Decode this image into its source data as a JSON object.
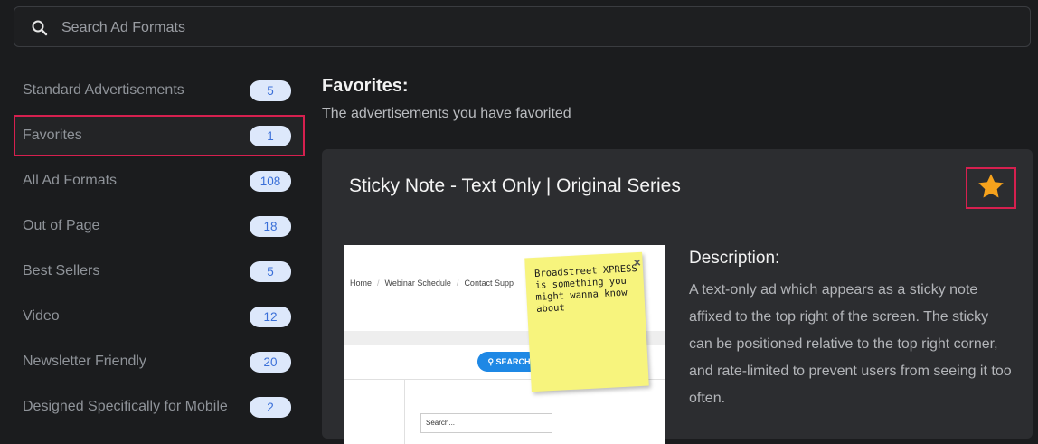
{
  "search": {
    "placeholder": "Search Ad Formats",
    "value": ""
  },
  "sidebar": {
    "items": [
      {
        "label": "Standard Advertisements",
        "count": "5"
      },
      {
        "label": "Favorites",
        "count": "1",
        "active": true
      },
      {
        "label": "All Ad Formats",
        "count": "108"
      },
      {
        "label": "Out of Page",
        "count": "18"
      },
      {
        "label": "Best Sellers",
        "count": "5"
      },
      {
        "label": "Video",
        "count": "12"
      },
      {
        "label": "Newsletter Friendly",
        "count": "20"
      },
      {
        "label": "Designed Specifically for Mobile",
        "count": "2"
      }
    ]
  },
  "main": {
    "title": "Favorites:",
    "subtitle": "The advertisements you have favorited"
  },
  "card": {
    "title": "Sticky Note - Text Only | Original Series",
    "favorited": true,
    "description_heading": "Description:",
    "description": "A text-only ad which appears as a sticky note affixed to the top right of the screen. The sticky can be positioned relative to the top right corner, and rate-limited to prevent users from seeing it too often.",
    "preview": {
      "crumbs": [
        "Home",
        "Webinar Schedule",
        "Contact Supp"
      ],
      "search_button": "SEARCH",
      "search_input": "Search...",
      "sticky_text": "Broadstreet XPRESS is something you might wanna know about",
      "close_glyph": "×"
    }
  },
  "colors": {
    "background": "#1b1c1e",
    "card": "#2c2d30",
    "highlight_border": "#d6204f",
    "badge_bg": "#dde8fb",
    "badge_text": "#3a6fd8",
    "star": "#f6a21c",
    "sticky": "#f7f47d"
  },
  "icons": {
    "search": "search-icon",
    "favorite": "star-icon"
  }
}
